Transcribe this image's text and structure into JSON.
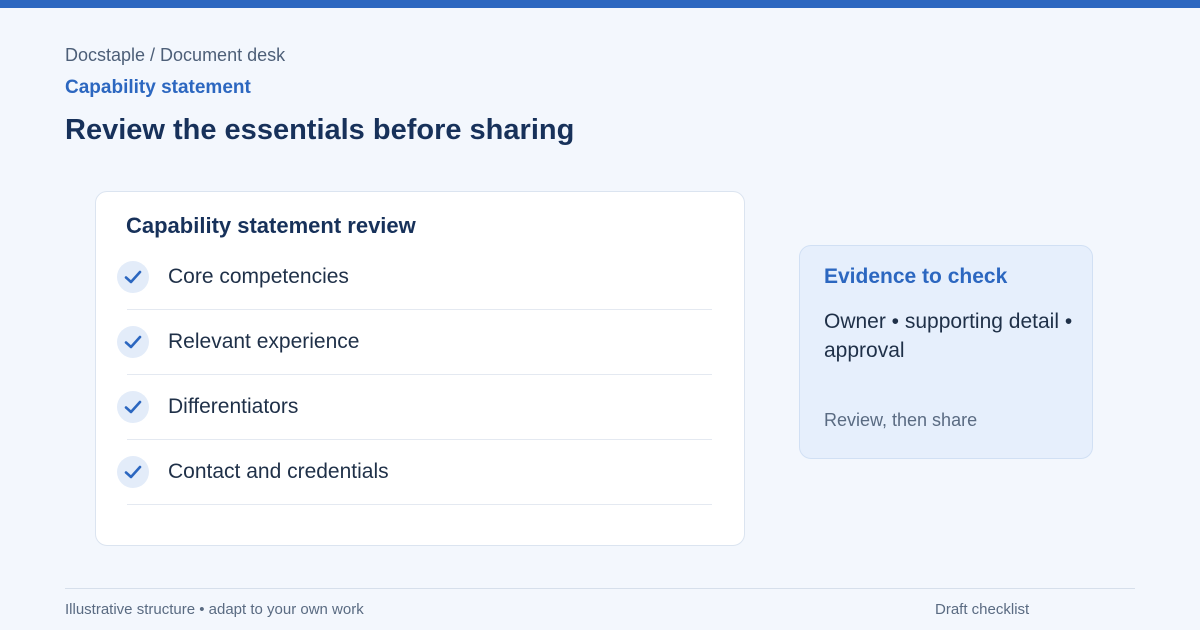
{
  "header": {
    "breadcrumb": "Docstaple / Document desk",
    "section_label": "Capability statement",
    "title": "Review the essentials before sharing"
  },
  "review_card": {
    "title": "Capability statement review",
    "items": [
      {
        "label": "Core competencies",
        "checked": true
      },
      {
        "label": "Relevant experience",
        "checked": true
      },
      {
        "label": "Differentiators",
        "checked": true
      },
      {
        "label": "Contact and credentials",
        "checked": true
      }
    ]
  },
  "evidence_card": {
    "title": "Evidence to check",
    "body": "Owner • supporting detail • approval",
    "note": "Review, then share"
  },
  "footer": {
    "left": "Illustrative structure • adapt to your own work",
    "right": "Draft checklist"
  },
  "colors": {
    "accent": "#2c67c0",
    "title": "#17315a",
    "background": "#f3f7fd"
  },
  "icons": {
    "check": "checkmark-icon"
  }
}
